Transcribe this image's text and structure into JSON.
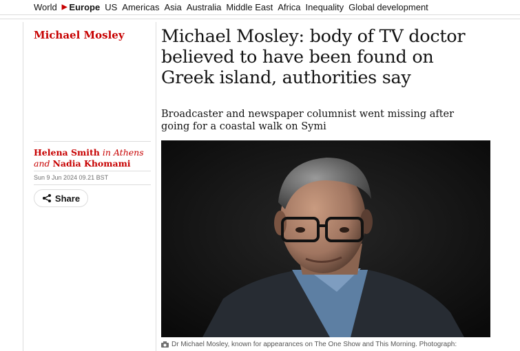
{
  "nav": {
    "items": [
      {
        "label": "World",
        "active": false
      },
      {
        "label": "Europe",
        "active": true
      },
      {
        "label": "US",
        "active": false
      },
      {
        "label": "Americas",
        "active": false
      },
      {
        "label": "Asia",
        "active": false
      },
      {
        "label": "Australia",
        "active": false
      },
      {
        "label": "Middle East",
        "active": false
      },
      {
        "label": "Africa",
        "active": false
      },
      {
        "label": "Inequality",
        "active": false
      },
      {
        "label": "Global development",
        "active": false
      }
    ],
    "active_arrow": "▶"
  },
  "article": {
    "kicker": "Michael Mosley",
    "headline": "Michael Mosley: body of TV doctor believed to have been found on Greek island, authorities say",
    "standfirst": "Broadcaster and newspaper columnist went missing after going for a coastal walk on Symi",
    "byline": {
      "author1": "Helena Smith",
      "location": " in Athens and ",
      "author2": "Nadia Khomami"
    },
    "date": "Sun 9 Jun 2024 09.21 BST",
    "share_label": "Share",
    "caption": "Dr Michael Mosley, known for appearances on The One Show and This Morning. Photograph:"
  },
  "colors": {
    "accent": "#c70000",
    "text": "#121212",
    "muted": "#707070",
    "rule": "#dcdcdc"
  },
  "icons": {
    "share": "share-icon",
    "camera": "camera-icon"
  }
}
